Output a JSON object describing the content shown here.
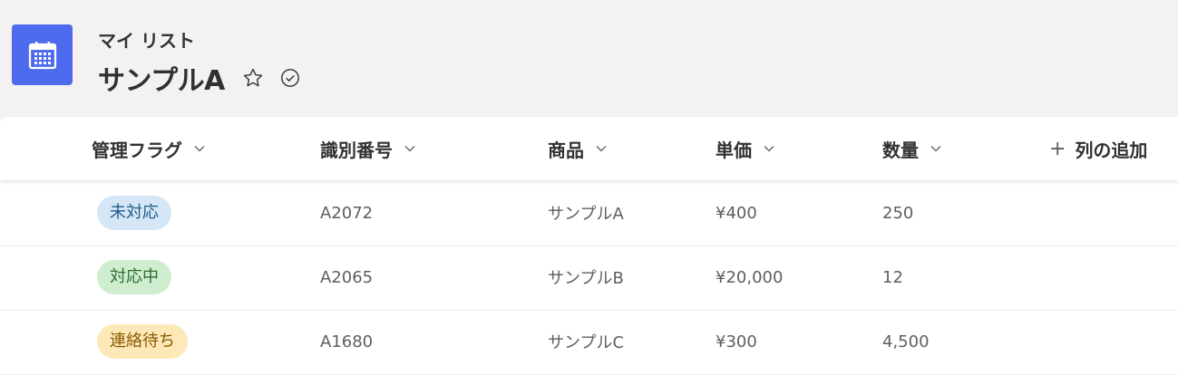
{
  "header": {
    "breadcrumb": "マイ リスト",
    "title": "サンプルA",
    "app_icon": "calendar-icon",
    "app_icon_color": "#4f6bed"
  },
  "columns": [
    {
      "label": "管理フラグ"
    },
    {
      "label": "識別番号"
    },
    {
      "label": "商品"
    },
    {
      "label": "単価"
    },
    {
      "label": "数量"
    }
  ],
  "add_column_label": "列の追加",
  "rows": [
    {
      "flag": "未対応",
      "flag_bg": "#d5e7f6",
      "flag_color": "#1f5c8c",
      "id": "A2072",
      "product": "サンプルA",
      "price": "¥400",
      "qty": "250"
    },
    {
      "flag": "対応中",
      "flag_bg": "#cfeed0",
      "flag_color": "#2f6b2f",
      "id": "A2065",
      "product": "サンプルB",
      "price": "¥20,000",
      "qty": "12"
    },
    {
      "flag": "連絡待ち",
      "flag_bg": "#fde8b8",
      "flag_color": "#8a5a00",
      "id": "A1680",
      "product": "サンプルC",
      "price": "¥300",
      "qty": "4,500"
    }
  ]
}
